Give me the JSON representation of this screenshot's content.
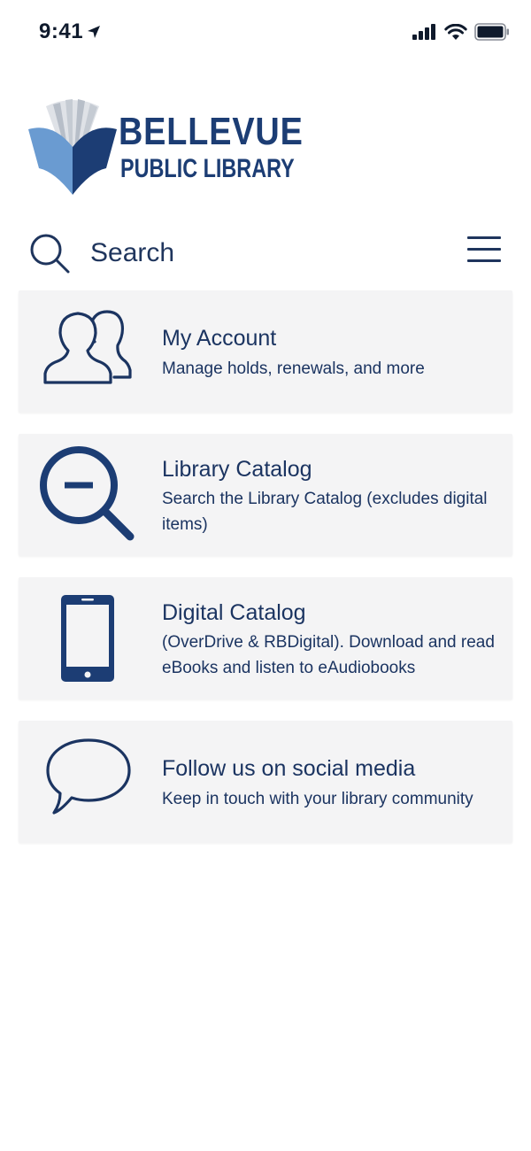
{
  "status_bar": {
    "time": "9:41",
    "icons": [
      "location-arrow-icon",
      "signal-icon",
      "wifi-icon",
      "battery-icon"
    ]
  },
  "logo": {
    "line1": "BELLEVUE",
    "line2": "PUBLIC LIBRARY"
  },
  "search": {
    "placeholder": "Search"
  },
  "menu": {
    "icon": "hamburger-menu-icon"
  },
  "cards": [
    {
      "icon": "people-icon",
      "title": "My Account",
      "description": "Manage holds, renewals, and more"
    },
    {
      "icon": "magnifier-minus-icon",
      "title": "Library Catalog",
      "description": "Search the Library Catalog (excludes digital items)"
    },
    {
      "icon": "smartphone-icon",
      "title": "Digital Catalog",
      "description": "(OverDrive & RBDigital). Download and read eBooks and listen to eAudiobooks"
    },
    {
      "icon": "speech-bubble-icon",
      "title": "Follow us on social media",
      "description": "Keep in touch with your library community"
    }
  ],
  "colors": {
    "brand_navy": "#1c3d74",
    "text_navy": "#1b3461",
    "card_background": "#f4f4f5",
    "logo_light_blue": "#6a9bd1",
    "logo_gray": "#b7bec8"
  }
}
